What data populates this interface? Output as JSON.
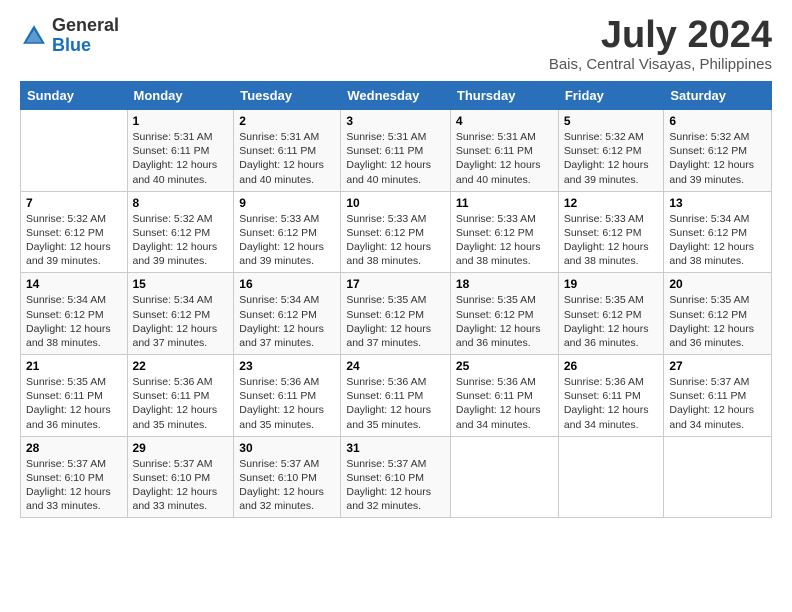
{
  "header": {
    "logo_general": "General",
    "logo_blue": "Blue",
    "month_year": "July 2024",
    "location": "Bais, Central Visayas, Philippines"
  },
  "weekdays": [
    "Sunday",
    "Monday",
    "Tuesday",
    "Wednesday",
    "Thursday",
    "Friday",
    "Saturday"
  ],
  "weeks": [
    [
      {
        "day": "",
        "sunrise": "",
        "sunset": "",
        "daylight": ""
      },
      {
        "day": "1",
        "sunrise": "Sunrise: 5:31 AM",
        "sunset": "Sunset: 6:11 PM",
        "daylight": "Daylight: 12 hours and 40 minutes."
      },
      {
        "day": "2",
        "sunrise": "Sunrise: 5:31 AM",
        "sunset": "Sunset: 6:11 PM",
        "daylight": "Daylight: 12 hours and 40 minutes."
      },
      {
        "day": "3",
        "sunrise": "Sunrise: 5:31 AM",
        "sunset": "Sunset: 6:11 PM",
        "daylight": "Daylight: 12 hours and 40 minutes."
      },
      {
        "day": "4",
        "sunrise": "Sunrise: 5:31 AM",
        "sunset": "Sunset: 6:11 PM",
        "daylight": "Daylight: 12 hours and 40 minutes."
      },
      {
        "day": "5",
        "sunrise": "Sunrise: 5:32 AM",
        "sunset": "Sunset: 6:12 PM",
        "daylight": "Daylight: 12 hours and 39 minutes."
      },
      {
        "day": "6",
        "sunrise": "Sunrise: 5:32 AM",
        "sunset": "Sunset: 6:12 PM",
        "daylight": "Daylight: 12 hours and 39 minutes."
      }
    ],
    [
      {
        "day": "7",
        "sunrise": "Sunrise: 5:32 AM",
        "sunset": "Sunset: 6:12 PM",
        "daylight": "Daylight: 12 hours and 39 minutes."
      },
      {
        "day": "8",
        "sunrise": "Sunrise: 5:32 AM",
        "sunset": "Sunset: 6:12 PM",
        "daylight": "Daylight: 12 hours and 39 minutes."
      },
      {
        "day": "9",
        "sunrise": "Sunrise: 5:33 AM",
        "sunset": "Sunset: 6:12 PM",
        "daylight": "Daylight: 12 hours and 39 minutes."
      },
      {
        "day": "10",
        "sunrise": "Sunrise: 5:33 AM",
        "sunset": "Sunset: 6:12 PM",
        "daylight": "Daylight: 12 hours and 38 minutes."
      },
      {
        "day": "11",
        "sunrise": "Sunrise: 5:33 AM",
        "sunset": "Sunset: 6:12 PM",
        "daylight": "Daylight: 12 hours and 38 minutes."
      },
      {
        "day": "12",
        "sunrise": "Sunrise: 5:33 AM",
        "sunset": "Sunset: 6:12 PM",
        "daylight": "Daylight: 12 hours and 38 minutes."
      },
      {
        "day": "13",
        "sunrise": "Sunrise: 5:34 AM",
        "sunset": "Sunset: 6:12 PM",
        "daylight": "Daylight: 12 hours and 38 minutes."
      }
    ],
    [
      {
        "day": "14",
        "sunrise": "Sunrise: 5:34 AM",
        "sunset": "Sunset: 6:12 PM",
        "daylight": "Daylight: 12 hours and 38 minutes."
      },
      {
        "day": "15",
        "sunrise": "Sunrise: 5:34 AM",
        "sunset": "Sunset: 6:12 PM",
        "daylight": "Daylight: 12 hours and 37 minutes."
      },
      {
        "day": "16",
        "sunrise": "Sunrise: 5:34 AM",
        "sunset": "Sunset: 6:12 PM",
        "daylight": "Daylight: 12 hours and 37 minutes."
      },
      {
        "day": "17",
        "sunrise": "Sunrise: 5:35 AM",
        "sunset": "Sunset: 6:12 PM",
        "daylight": "Daylight: 12 hours and 37 minutes."
      },
      {
        "day": "18",
        "sunrise": "Sunrise: 5:35 AM",
        "sunset": "Sunset: 6:12 PM",
        "daylight": "Daylight: 12 hours and 36 minutes."
      },
      {
        "day": "19",
        "sunrise": "Sunrise: 5:35 AM",
        "sunset": "Sunset: 6:12 PM",
        "daylight": "Daylight: 12 hours and 36 minutes."
      },
      {
        "day": "20",
        "sunrise": "Sunrise: 5:35 AM",
        "sunset": "Sunset: 6:12 PM",
        "daylight": "Daylight: 12 hours and 36 minutes."
      }
    ],
    [
      {
        "day": "21",
        "sunrise": "Sunrise: 5:35 AM",
        "sunset": "Sunset: 6:11 PM",
        "daylight": "Daylight: 12 hours and 36 minutes."
      },
      {
        "day": "22",
        "sunrise": "Sunrise: 5:36 AM",
        "sunset": "Sunset: 6:11 PM",
        "daylight": "Daylight: 12 hours and 35 minutes."
      },
      {
        "day": "23",
        "sunrise": "Sunrise: 5:36 AM",
        "sunset": "Sunset: 6:11 PM",
        "daylight": "Daylight: 12 hours and 35 minutes."
      },
      {
        "day": "24",
        "sunrise": "Sunrise: 5:36 AM",
        "sunset": "Sunset: 6:11 PM",
        "daylight": "Daylight: 12 hours and 35 minutes."
      },
      {
        "day": "25",
        "sunrise": "Sunrise: 5:36 AM",
        "sunset": "Sunset: 6:11 PM",
        "daylight": "Daylight: 12 hours and 34 minutes."
      },
      {
        "day": "26",
        "sunrise": "Sunrise: 5:36 AM",
        "sunset": "Sunset: 6:11 PM",
        "daylight": "Daylight: 12 hours and 34 minutes."
      },
      {
        "day": "27",
        "sunrise": "Sunrise: 5:37 AM",
        "sunset": "Sunset: 6:11 PM",
        "daylight": "Daylight: 12 hours and 34 minutes."
      }
    ],
    [
      {
        "day": "28",
        "sunrise": "Sunrise: 5:37 AM",
        "sunset": "Sunset: 6:10 PM",
        "daylight": "Daylight: 12 hours and 33 minutes."
      },
      {
        "day": "29",
        "sunrise": "Sunrise: 5:37 AM",
        "sunset": "Sunset: 6:10 PM",
        "daylight": "Daylight: 12 hours and 33 minutes."
      },
      {
        "day": "30",
        "sunrise": "Sunrise: 5:37 AM",
        "sunset": "Sunset: 6:10 PM",
        "daylight": "Daylight: 12 hours and 32 minutes."
      },
      {
        "day": "31",
        "sunrise": "Sunrise: 5:37 AM",
        "sunset": "Sunset: 6:10 PM",
        "daylight": "Daylight: 12 hours and 32 minutes."
      },
      {
        "day": "",
        "sunrise": "",
        "sunset": "",
        "daylight": ""
      },
      {
        "day": "",
        "sunrise": "",
        "sunset": "",
        "daylight": ""
      },
      {
        "day": "",
        "sunrise": "",
        "sunset": "",
        "daylight": ""
      }
    ]
  ]
}
